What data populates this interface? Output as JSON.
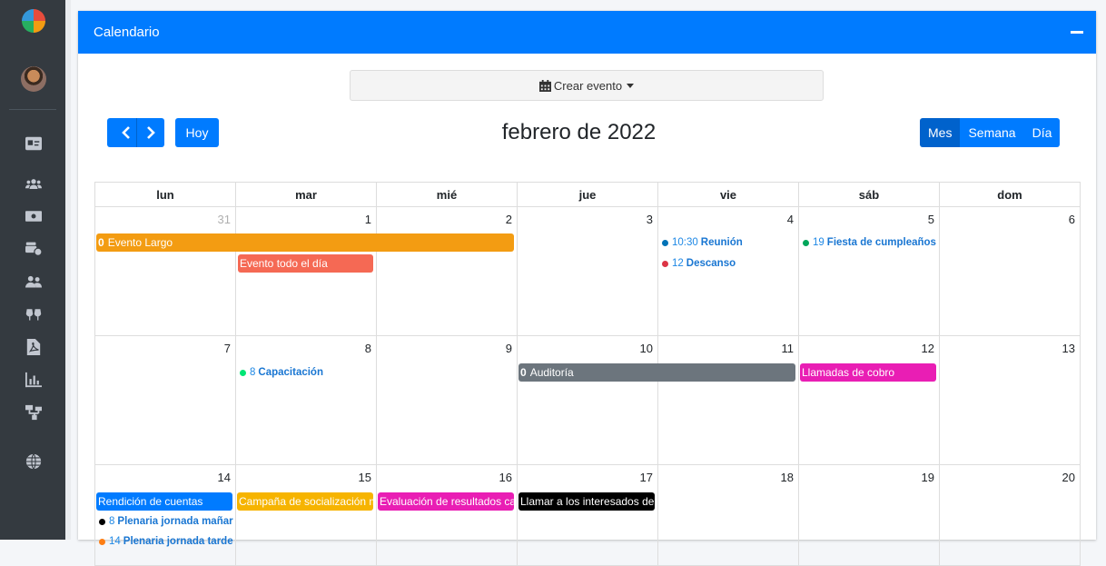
{
  "card": {
    "title": "Calendario"
  },
  "toolbar": {
    "create_label": "Crear evento",
    "today_label": "Hoy",
    "title": "febrero de 2022",
    "views": [
      "Mes",
      "Semana",
      "Día"
    ],
    "active_view": "Mes"
  },
  "weekdays": [
    "lun",
    "mar",
    "mié",
    "jue",
    "vie",
    "sáb",
    "dom"
  ],
  "weeks": [
    {
      "days": [
        "31",
        "1",
        "2",
        "3",
        "4",
        "5",
        "6"
      ]
    },
    {
      "days": [
        "7",
        "8",
        "9",
        "10",
        "11",
        "12",
        "13"
      ]
    },
    {
      "days": [
        "14",
        "15",
        "16",
        "17",
        "18",
        "19",
        "20"
      ]
    }
  ],
  "events": {
    "evento_largo": {
      "time": "0",
      "title": "Evento Largo",
      "color": "#f39c12"
    },
    "evento_todo_dia": {
      "title": "Evento todo el día",
      "color": "#f56954"
    },
    "reunion": {
      "time": "10:30",
      "title": "Reunión",
      "color": "#0073b7"
    },
    "descanso": {
      "time": "12",
      "title": "Descanso",
      "color": "#dc3545"
    },
    "fiesta": {
      "time": "19",
      "title": "Fiesta de cumpleaños",
      "color": "#00a65a"
    },
    "capacitacion": {
      "time": "8",
      "title": "Capacitación",
      "color": "#00e676"
    },
    "auditoria": {
      "time": "0",
      "title": "Auditoría",
      "color": "#6c757d"
    },
    "llamadas_cobro": {
      "title": "Llamadas de cobro",
      "color": "#e91eb4"
    },
    "rendicion": {
      "title": "Rendición de cuentas",
      "color": "#007bff"
    },
    "campana": {
      "title": "Campaña de socialización mi",
      "color": "#f6b400"
    },
    "evaluacion": {
      "title": "Evaluación de resultados can",
      "color": "#e91eb4"
    },
    "llamar_interesados": {
      "title": "Llamar a los interesados de la",
      "color": "#000000"
    },
    "plenaria_manana": {
      "time": "8",
      "title": "Plenaria jornada mañar",
      "color": "#000000"
    },
    "plenaria_tarde": {
      "time": "14",
      "title": "Plenaria jornada tarde",
      "color": "#fd7e14"
    }
  }
}
